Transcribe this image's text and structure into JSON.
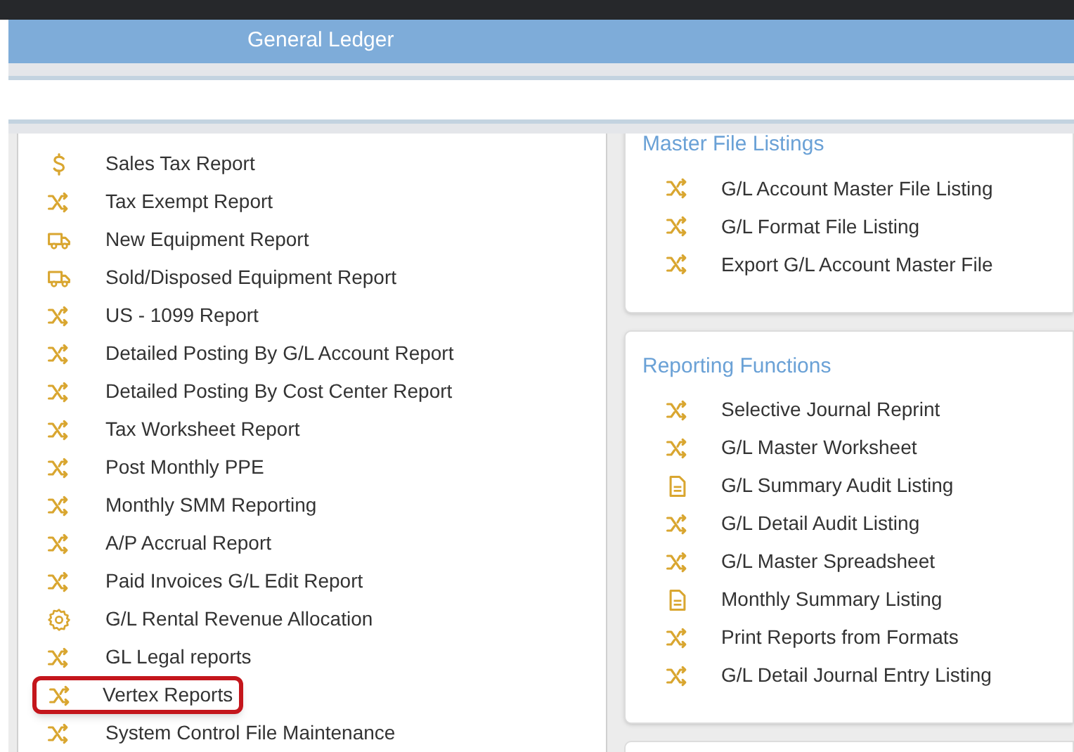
{
  "header": {
    "title": "General Ledger"
  },
  "left_list": [
    {
      "label": "Sales Tax Report",
      "kind": "dollar",
      "highlighted": false
    },
    {
      "label": "Tax Exempt Report",
      "kind": "shuffle",
      "highlighted": false
    },
    {
      "label": "New Equipment Report",
      "kind": "truck",
      "highlighted": false
    },
    {
      "label": "Sold/Disposed Equipment Report",
      "kind": "truck",
      "highlighted": false
    },
    {
      "label": "US - 1099 Report",
      "kind": "shuffle",
      "highlighted": false
    },
    {
      "label": "Detailed Posting By G/L Account Report",
      "kind": "shuffle",
      "highlighted": false
    },
    {
      "label": "Detailed Posting By Cost Center Report",
      "kind": "shuffle",
      "highlighted": false
    },
    {
      "label": "Tax Worksheet Report",
      "kind": "shuffle",
      "highlighted": false
    },
    {
      "label": "Post Monthly PPE",
      "kind": "shuffle",
      "highlighted": false
    },
    {
      "label": "Monthly SMM Reporting",
      "kind": "shuffle",
      "highlighted": false
    },
    {
      "label": "A/P Accrual Report",
      "kind": "shuffle",
      "highlighted": false
    },
    {
      "label": "Paid Invoices G/L Edit Report",
      "kind": "shuffle",
      "highlighted": false
    },
    {
      "label": "G/L Rental Revenue Allocation",
      "kind": "gear",
      "highlighted": false
    },
    {
      "label": "GL Legal reports",
      "kind": "shuffle",
      "highlighted": false
    },
    {
      "label": "Vertex Reports",
      "kind": "shuffle",
      "highlighted": true
    },
    {
      "label": "System Control File Maintenance",
      "kind": "shuffle",
      "highlighted": false
    }
  ],
  "panels": [
    {
      "title": "Master File Listings",
      "items": [
        {
          "label": "G/L Account Master File Listing",
          "kind": "shuffle"
        },
        {
          "label": "G/L Format File Listing",
          "kind": "shuffle"
        },
        {
          "label": "Export G/L Account Master File",
          "kind": "shuffle"
        }
      ]
    },
    {
      "title": "Reporting Functions",
      "items": [
        {
          "label": "Selective Journal Reprint",
          "kind": "shuffle"
        },
        {
          "label": "G/L Master Worksheet",
          "kind": "shuffle"
        },
        {
          "label": "G/L Summary Audit Listing",
          "kind": "document"
        },
        {
          "label": "G/L Detail Audit Listing",
          "kind": "shuffle"
        },
        {
          "label": "G/L Master Spreadsheet",
          "kind": "shuffle"
        },
        {
          "label": "Monthly Summary Listing",
          "kind": "document"
        },
        {
          "label": "Print Reports from Formats",
          "kind": "shuffle"
        },
        {
          "label": "G/L Detail Journal Entry Listing",
          "kind": "shuffle"
        }
      ]
    }
  ]
}
